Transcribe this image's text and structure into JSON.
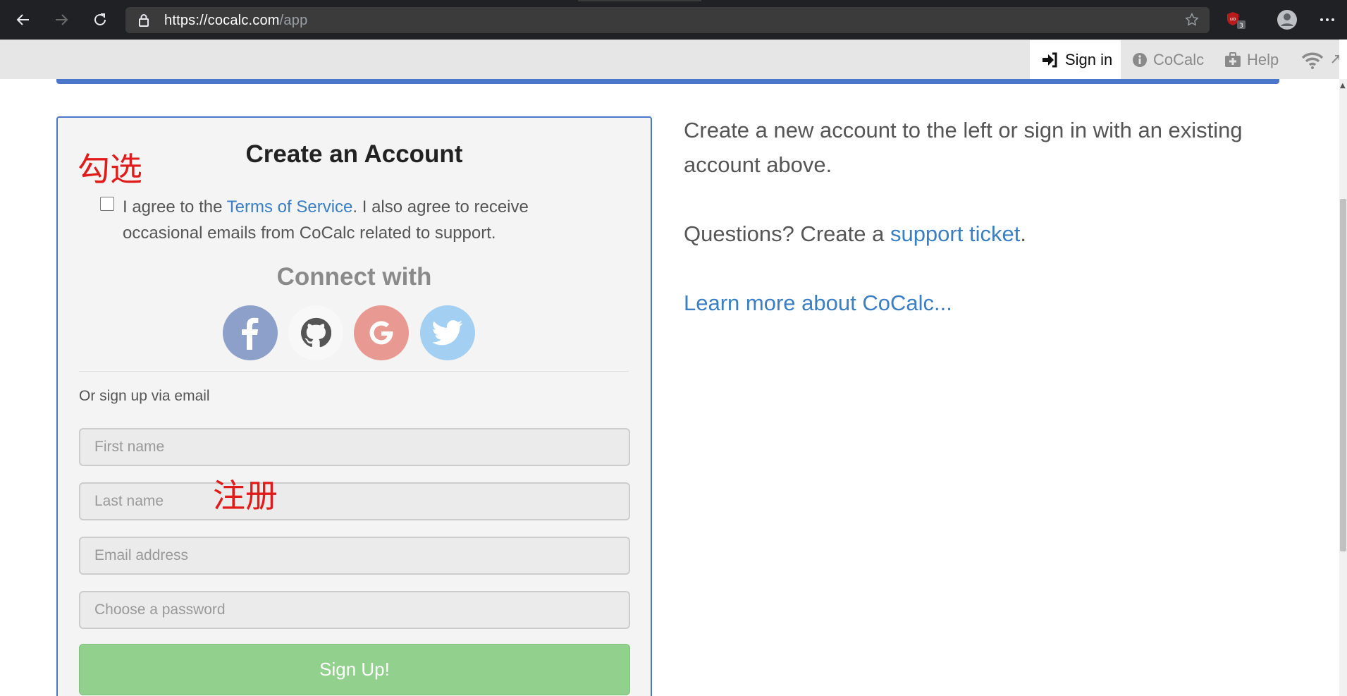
{
  "browser": {
    "url_host": "https://cocalc.com",
    "url_path": "/app",
    "extension_badge": "3"
  },
  "nav": {
    "signin_label": "Sign in",
    "cocalc_label": "CoCalc",
    "help_label": "Help"
  },
  "card": {
    "title": "Create an Account",
    "agree_prefix": "I agree to the ",
    "terms_link": "Terms of Service",
    "agree_suffix": ". I also agree to receive occasional emails from CoCalc related to support.",
    "connect_title": "Connect with",
    "email_label": "Or sign up via email",
    "first_name_placeholder": "First name",
    "last_name_placeholder": "Last name",
    "email_placeholder": "Email address",
    "password_placeholder": "Choose a password",
    "signup_label": "Sign Up!"
  },
  "social_colors": {
    "facebook": "#8da0c9",
    "github": "#f8f8f8",
    "google": "#e89a92",
    "twitter": "#a3cff2"
  },
  "annotations": {
    "check_hint": "勾选",
    "register_hint": "注册"
  },
  "right": {
    "intro": "Create a new account to the left or sign in with an existing account above.",
    "questions_prefix": "Questions? Create a ",
    "support_link": "support ticket",
    "questions_suffix": ".",
    "learn_more": "Learn more about CoCalc..."
  }
}
